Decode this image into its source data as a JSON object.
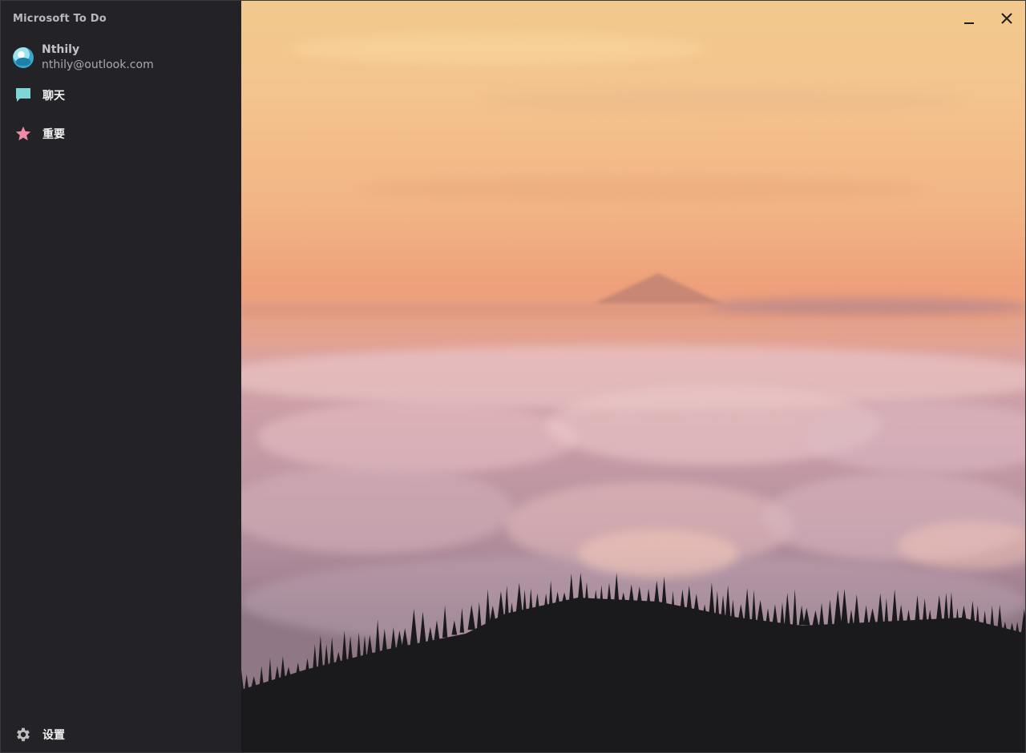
{
  "app": {
    "title": "Microsoft To Do"
  },
  "account": {
    "name": "Nthily",
    "email": "nthily@outlook.com"
  },
  "nav": {
    "chat": {
      "label": "聊天",
      "icon": "chat-bubble-icon",
      "color": "#7ed6d6"
    },
    "important": {
      "label": "重要",
      "icon": "star-icon",
      "color": "#f08aa6"
    },
    "settings": {
      "label": "设置",
      "icon": "gear-icon",
      "color": "#bdbdbd"
    }
  },
  "window_controls": {
    "minimize_icon": "minimize-icon",
    "close_icon": "close-icon"
  },
  "colors": {
    "sidebar_bg": "#232327",
    "text": "#f2f2f2"
  }
}
